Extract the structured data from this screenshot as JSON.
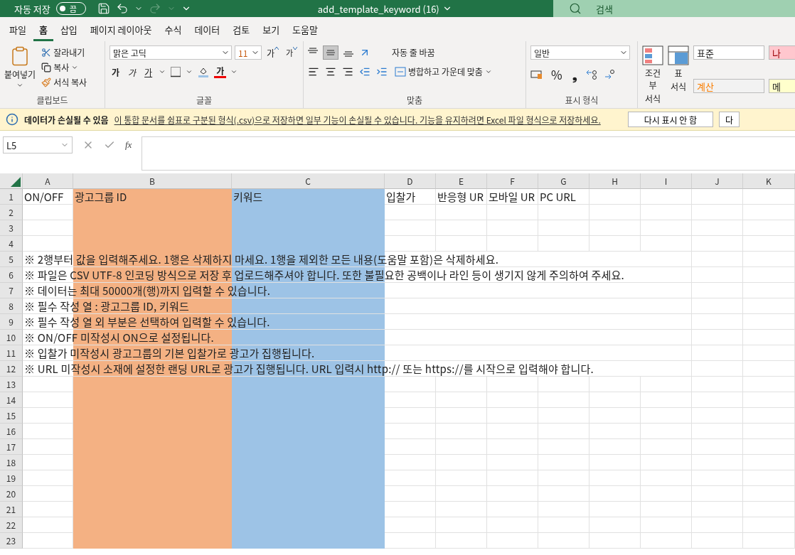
{
  "title_bar": {
    "autosave_label": "자동 저장",
    "autosave_toggle": {
      "label": "끔",
      "on": false
    },
    "filename": "add_template_keyword (16)",
    "search": {
      "placeholder": "검색"
    }
  },
  "menu_tabs": [
    {
      "label": "파일",
      "selected": false
    },
    {
      "label": "홈",
      "selected": true
    },
    {
      "label": "삽입",
      "selected": false
    },
    {
      "label": "페이지 레이아웃",
      "selected": false
    },
    {
      "label": "수식",
      "selected": false
    },
    {
      "label": "데이터",
      "selected": false
    },
    {
      "label": "검토",
      "selected": false
    },
    {
      "label": "보기",
      "selected": false
    },
    {
      "label": "도움말",
      "selected": false
    }
  ],
  "ribbon": {
    "clipboard": {
      "paste": "붙여넣기",
      "cut": "잘라내기",
      "copy": "복사",
      "format_painter": "서식 복사",
      "label": "클립보드"
    },
    "font": {
      "font_name": "맑은 고딕",
      "font_size": "11",
      "grow": "가",
      "shrink": "가",
      "bold": "가",
      "italic": "가",
      "underline": "가",
      "font_color": "가",
      "label": "글꼴"
    },
    "alignment": {
      "wrap_text": "자동 줄 바꿈",
      "merge_center": "병합하고 가운데 맞춤",
      "label": "맞춤",
      "middle_align_selected": true
    },
    "number": {
      "format": "일반",
      "percent": "%",
      "comma": "❟",
      "label": "표시 형식"
    },
    "styles": {
      "conditional": [
        "조건부",
        "서식"
      ],
      "table": [
        "표",
        "서식"
      ],
      "cell_styles": [
        {
          "label": "표준",
          "color": "#ffffff"
        },
        {
          "label": "나",
          "color": "#ffc7ce"
        },
        {
          "label": "계산",
          "color": "#f2f2f2"
        },
        {
          "label": "메",
          "color": "#ffffcc"
        }
      ]
    }
  },
  "info_bar": {
    "title": "데이터가 손실될 수 있음",
    "message": "이 통합 문서를 쉼표로 구분된 형식(.csv)으로 저장하면 일부 기능이 손실될 수 있습니다. 기능을 유지하려면 Excel 파일 형식으로 저장하세요.",
    "buttons": [
      "다시 표시 안 함",
      "다"
    ]
  },
  "formula_bar": {
    "name_box": "L5",
    "function_label": "fx"
  },
  "sheet": {
    "columns": [
      {
        "label": "A"
      },
      {
        "label": "B",
        "color": "#f4b183"
      },
      {
        "label": "C",
        "color": "#9dc3e6"
      },
      {
        "label": "D"
      },
      {
        "label": "E"
      },
      {
        "label": "F"
      },
      {
        "label": "G"
      },
      {
        "label": "H"
      },
      {
        "label": "I"
      },
      {
        "label": "J"
      },
      {
        "label": "K"
      }
    ],
    "rows": [
      {
        "number": "1",
        "cells": [
          "ON/OFF",
          "광고그룹 ID",
          "키워드",
          "입찰가",
          "반응형 UR",
          "모바일 UR",
          "PC URL"
        ]
      },
      {
        "number": "2"
      },
      {
        "number": "3"
      },
      {
        "number": "4"
      },
      {
        "number": "5",
        "note": "※ 2행부터 값을 입력해주세요. 1행은 삭제하지 마세요. 1행을 제외한 모든 내용(도움말 포함)은 삭제하세요."
      },
      {
        "number": "6",
        "note": "※ 파일은 CSV UTF-8 인코딩 방식으로 저장 후 업로드해주셔야 합니다. 또한 불필요한 공백이나 라인 등이 생기지 않게 주의하여 주세요."
      },
      {
        "number": "7",
        "note": "※ 데이터는 최대 50000개(행)까지 입력할 수 있습니다."
      },
      {
        "number": "8",
        "note": "※ 필수 작성 열 : 광고그룹 ID, 키워드"
      },
      {
        "number": "9",
        "note": "※ 필수 작성 열 외 부분은 선택하여 입력할 수 있습니다."
      },
      {
        "number": "10",
        "note": "※ ON/OFF 미작성시 ON으로 설정됩니다."
      },
      {
        "number": "11",
        "note": "※ 입찰가 미작성시 광고그룹의 기본 입찰가로 광고가 집행됩니다."
      },
      {
        "number": "12",
        "note": "※ URL 미작성시 소재에 설정한 랜딩 URL로 광고가 집행됩니다. URL 입력시 http:// 또는 https://를 시작으로 입력해야 합니다."
      },
      {
        "number": "13"
      },
      {
        "number": "14"
      },
      {
        "number": "15"
      },
      {
        "number": "16"
      },
      {
        "number": "17"
      },
      {
        "number": "18"
      },
      {
        "number": "19"
      },
      {
        "number": "20"
      },
      {
        "number": "21"
      },
      {
        "number": "22"
      },
      {
        "number": "23"
      }
    ]
  }
}
